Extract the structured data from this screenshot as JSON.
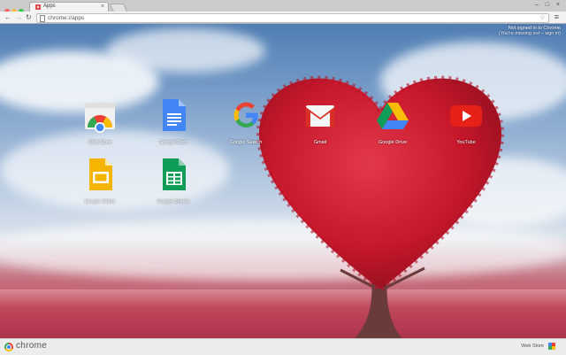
{
  "tab": {
    "title": "Apps",
    "close": "×"
  },
  "window_controls": "– □ ×",
  "toolbar": {
    "back": "←",
    "forward": "→",
    "reload": "↻",
    "url": "chrome://apps",
    "bookmark": "☆",
    "menu": "≡"
  },
  "signin": {
    "line1": "Not signed in to Chrome",
    "line2": "(You're missing out – sign in)"
  },
  "apps": [
    {
      "label": "Web Store",
      "icon": "web-store-icon"
    },
    {
      "label": "Google Docs",
      "icon": "google-docs-icon"
    },
    {
      "label": "Google Search",
      "icon": "google-search-icon"
    },
    {
      "label": "Gmail",
      "icon": "gmail-icon"
    },
    {
      "label": "Google Drive",
      "icon": "google-drive-icon"
    },
    {
      "label": "YouTube",
      "icon": "youtube-icon"
    },
    {
      "label": "Google Slides",
      "icon": "google-slides-icon"
    },
    {
      "label": "Google Sheets",
      "icon": "google-sheets-icon"
    }
  ],
  "bottombar": {
    "brand": "chrome",
    "webstore": "Web Store"
  },
  "colors": {
    "tree_red": "#c8182b",
    "sky_blue": "#5b86ba",
    "bar_gray": "#ececec"
  }
}
